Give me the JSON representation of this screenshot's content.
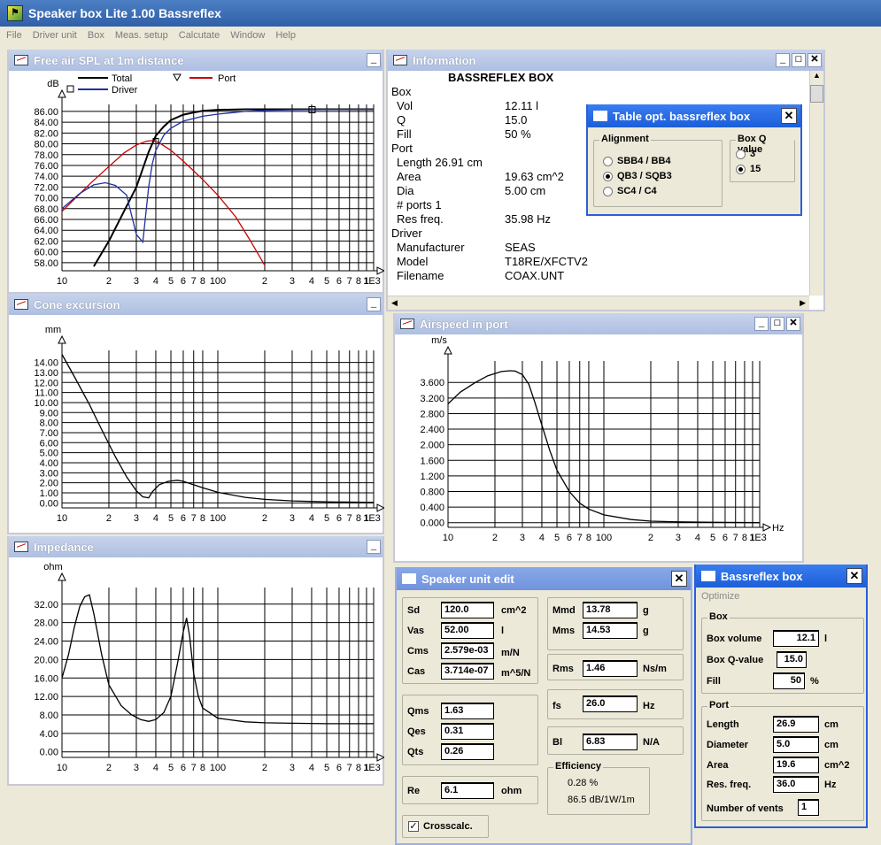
{
  "app": {
    "title": "Speaker box Lite 1.00 Bassreflex"
  },
  "menu": [
    "File",
    "Driver unit",
    "Box",
    "Meas. setup",
    "Calcutate",
    "Window",
    "Help"
  ],
  "spl_window": {
    "title": "Free air SPL at 1m distance",
    "chart_data": {
      "type": "line",
      "ylabel": "dB",
      "xscale": "log",
      "x_ticks": [
        "10",
        "2",
        "3",
        "4",
        "5",
        "6",
        "7",
        "8",
        "100",
        "2",
        "3",
        "4",
        "5",
        "6",
        "7",
        "8",
        "1",
        "1E3"
      ],
      "y_ticks": [
        "86.00",
        "84.00",
        "82.00",
        "80.00",
        "78.00",
        "76.00",
        "74.00",
        "72.00",
        "70.00",
        "68.00",
        "66.00",
        "64.00",
        "62.00",
        "60.00",
        "58.00"
      ],
      "ylim": [
        56.5,
        87.3
      ],
      "legend": [
        "Total",
        "Port",
        "Driver"
      ],
      "series": [
        {
          "name": "Total",
          "color": "#000000",
          "x": [
            16,
            20,
            25,
            30,
            36,
            40,
            45,
            50,
            60,
            70,
            80,
            100,
            150,
            200,
            400,
            1000
          ],
          "y": [
            57.3,
            62,
            67.5,
            72,
            78.5,
            81.5,
            83.2,
            84.4,
            85.4,
            85.8,
            86.1,
            86.3,
            86.4,
            86.4,
            86.4,
            86.4
          ]
        },
        {
          "name": "Port",
          "color": "#cc0000",
          "x": [
            10,
            15,
            20,
            25,
            30,
            35,
            38,
            42,
            50,
            60,
            70,
            80,
            100,
            130,
            160,
            200
          ],
          "y": [
            67.5,
            72.5,
            75.8,
            78.3,
            79.8,
            80.5,
            80.6,
            80.2,
            78.8,
            76.8,
            75,
            73.4,
            70.5,
            66.5,
            62.3,
            57.5
          ]
        },
        {
          "name": "Driver",
          "color": "#2030a0",
          "x": [
            10,
            13,
            16,
            19,
            22,
            26,
            30,
            33,
            36,
            38,
            40,
            45,
            50,
            60,
            80,
            100,
            150,
            200,
            300,
            1000
          ],
          "y": [
            68,
            70.8,
            72.4,
            72.8,
            72.3,
            70.5,
            63.2,
            61.8,
            72,
            76.3,
            78.8,
            81.6,
            82.9,
            84.2,
            85.1,
            85.5,
            86,
            86.2,
            86.3,
            86.4
          ]
        }
      ]
    }
  },
  "cone_window": {
    "title": "Cone excursion",
    "chart_data": {
      "type": "line",
      "ylabel": "mm",
      "xlabel": "H",
      "xscale": "log",
      "x_ticks": [
        "10",
        "2",
        "3",
        "4",
        "5",
        "6",
        "7",
        "8",
        "100",
        "2",
        "3",
        "4",
        "5",
        "6",
        "7",
        "8",
        "1",
        "1E3"
      ],
      "y_ticks": [
        "14.00",
        "13.00",
        "12.00",
        "11.00",
        "10.00",
        "9.00",
        "8.00",
        "7.00",
        "6.00",
        "5.00",
        "4.00",
        "3.00",
        "2.00",
        "1.00",
        "0.00"
      ],
      "ylim": [
        -0.5,
        15.2
      ],
      "series": [
        {
          "name": "Excursion",
          "color": "#000000",
          "x": [
            10,
            12,
            15,
            18,
            22,
            26,
            30,
            33,
            36,
            38,
            42,
            48,
            55,
            60,
            70,
            80,
            100,
            150,
            200,
            300,
            500,
            1000
          ],
          "y": [
            14.8,
            12.6,
            9.8,
            7.3,
            4.6,
            2.6,
            1.2,
            0.6,
            0.5,
            1.1,
            1.8,
            2.15,
            2.25,
            2.15,
            1.8,
            1.5,
            1.05,
            0.55,
            0.35,
            0.2,
            0.1,
            0.05
          ]
        }
      ]
    }
  },
  "impedance_window": {
    "title": "Impedance",
    "chart_data": {
      "type": "line",
      "ylabel": "ohm",
      "xlabel": "H",
      "xscale": "log",
      "x_ticks": [
        "10",
        "2",
        "3",
        "4",
        "5",
        "6",
        "7",
        "8",
        "100",
        "2",
        "3",
        "4",
        "5",
        "6",
        "7",
        "8",
        "1",
        "1E3"
      ],
      "y_ticks": [
        "32.00",
        "28.00",
        "24.00",
        "20.00",
        "16.00",
        "12.00",
        "8.00",
        "4.00",
        "0.00"
      ],
      "ylim": [
        -1.2,
        35.6
      ],
      "series": [
        {
          "name": "Impedance",
          "color": "#000000",
          "x": [
            10,
            11,
            12,
            13,
            14,
            15,
            16,
            18,
            20,
            24,
            28,
            32,
            36,
            40,
            45,
            50,
            55,
            60,
            63,
            66,
            70,
            75,
            80,
            100,
            150,
            200,
            300,
            500,
            1000
          ],
          "y": [
            16,
            21,
            27,
            31.5,
            33.6,
            34,
            30,
            21,
            14.5,
            10,
            8,
            7,
            6.6,
            7,
            8.5,
            12,
            19,
            26,
            29,
            25,
            17,
            12,
            9.5,
            7.3,
            6.5,
            6.3,
            6.2,
            6.1,
            6.1
          ]
        }
      ]
    }
  },
  "info_window": {
    "title": "Information",
    "heading": "BASSREFLEX BOX",
    "box_label": "Box",
    "vol_label": "Vol",
    "vol_value": "12.11 l",
    "q_label": "Q",
    "q_value": "15.0",
    "fill_label": "Fill",
    "fill_value": "50 %",
    "port_label": "Port",
    "length_text": "Length   26.91 cm",
    "area_label": "Area",
    "area_value": "19.63 cm^2",
    "dia_label": "Dia",
    "dia_value": "5.00 cm",
    "ports_text": "# ports   1",
    "resfreq_label": "Res freq.",
    "resfreq_value": "35.98 Hz",
    "driver_label": "Driver",
    "manufacturer_label": "Manufacturer",
    "manufacturer_value": "SEAS",
    "model_label": "Model",
    "model_value": "T18RE/XFCTV2",
    "filename_label": "Filename",
    "filename_value": "COAX.UNT"
  },
  "table_dialog": {
    "title": "Table opt. bassreflex box",
    "alignment_label": "Alignment",
    "alignments": [
      "SBB4 / BB4",
      "QB3 / SQB3",
      "SC4 / C4"
    ],
    "alignment_selected": "QB3 / SQB3",
    "boxq_label": "Box Q value",
    "boxq_options": [
      "3",
      "15"
    ],
    "boxq_selected": "15"
  },
  "airspeed_window": {
    "title": "Airspeed in port",
    "chart_data": {
      "type": "line",
      "ylabel": "m/s",
      "xlabel": "Hz",
      "xscale": "log",
      "x_ticks": [
        "10",
        "2",
        "3",
        "4",
        "5",
        "6",
        "7",
        "8",
        "100",
        "2",
        "3",
        "4",
        "5",
        "6",
        "7",
        "8",
        "1",
        "1E3"
      ],
      "y_ticks": [
        "3.600",
        "3.200",
        "2.800",
        "2.400",
        "2.000",
        "1.600",
        "1.200",
        "0.800",
        "0.400",
        "0.000"
      ],
      "ylim": [
        -0.12,
        4.15
      ],
      "series": [
        {
          "name": "Airspeed",
          "color": "#000000",
          "x": [
            10,
            12,
            15,
            18,
            22,
            25,
            27,
            30,
            33,
            36,
            40,
            45,
            50,
            60,
            70,
            80,
            100,
            150,
            200,
            300,
            500,
            1000
          ],
          "y": [
            3.05,
            3.35,
            3.6,
            3.77,
            3.88,
            3.9,
            3.89,
            3.8,
            3.55,
            3.1,
            2.5,
            1.85,
            1.35,
            0.8,
            0.5,
            0.35,
            0.2,
            0.08,
            0.04,
            0.02,
            0.01,
            0
          ]
        }
      ]
    }
  },
  "speaker_edit": {
    "title": "Speaker unit edit",
    "sd_label": "Sd",
    "sd_value": "120.0",
    "sd_unit": "cm^2",
    "vas_label": "Vas",
    "vas_value": "52.00",
    "vas_unit": "l",
    "cms_label": "Cms",
    "cms_value": "2.579e-03",
    "cms_unit": "m/N",
    "cas_label": "Cas",
    "cas_value": "3.714e-07",
    "cas_unit": "m^5/N",
    "mmd_label": "Mmd",
    "mmd_value": "13.78",
    "mmd_unit": "g",
    "mms_label": "Mms",
    "mms_value": "14.53",
    "mms_unit": "g",
    "rms_label": "Rms",
    "rms_value": "1.46",
    "rms_unit": "Ns/m",
    "qms_label": "Qms",
    "qms_value": "1.63",
    "qes_label": "Qes",
    "qes_value": "0.31",
    "qts_label": "Qts",
    "qts_value": "0.26",
    "fs_label": "fs",
    "fs_value": "26.0",
    "fs_unit": "Hz",
    "bl_label": "Bl",
    "bl_value": "6.83",
    "bl_unit": "N/A",
    "re_label": "Re",
    "re_value": "6.1",
    "re_unit": "ohm",
    "efficiency_label": "Efficiency",
    "efficiency_pct": "0.28 %",
    "efficiency_db": "86.5 dB/1W/1m",
    "crosscalc_label": "Crosscalc.",
    "crosscalc_checked": true
  },
  "bassreflex_dialog": {
    "title": "Bassreflex box",
    "optimize_label": "Optimize",
    "box_group": "Box",
    "volume_label": "Box volume",
    "volume_value": "12.1",
    "volume_unit": "l",
    "q_label": "Box Q-value",
    "q_value": "15.0",
    "fill_label": "Fill",
    "fill_value": "50",
    "fill_unit": "%",
    "port_group": "Port",
    "length_label": "Length",
    "length_value": "26.9",
    "length_unit": "cm",
    "diameter_label": "Diameter",
    "diameter_value": "5.0",
    "diameter_unit": "cm",
    "area_label": "Area",
    "area_value": "19.6",
    "area_unit": "cm^2",
    "resfreq_label": "Res. freq.",
    "resfreq_value": "36.0",
    "resfreq_unit": "Hz",
    "vents_label": "Number of vents",
    "vents_value": "1"
  }
}
